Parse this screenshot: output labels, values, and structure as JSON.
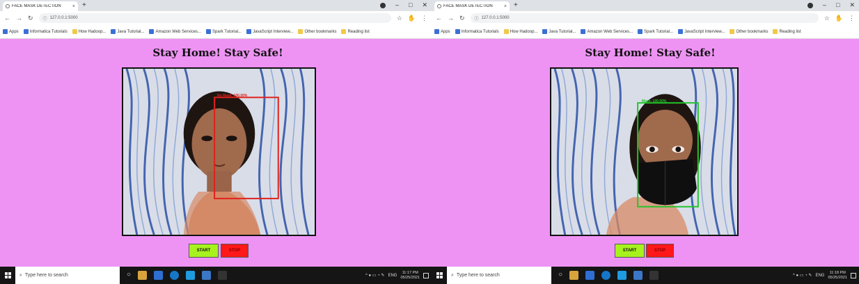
{
  "screens": [
    {
      "id": "left",
      "browser": {
        "tab_title": "FACE MASK DETECTION",
        "tab_close": "×",
        "new_tab": "+",
        "window_controls": [
          "–",
          "□",
          "✕"
        ],
        "address": "127.0.0.1:5000",
        "bookmarks": [
          "Apps",
          "Informatica Tutorials",
          "How Hadoop...",
          "Java Tutorial...",
          "Amazon Web Services...",
          "Spark Tutorial...",
          "JavaScript Interview...",
          "Other bookmarks",
          "Reading list"
        ]
      },
      "page": {
        "heading": "Stay Home! Stay Safe!"
      },
      "camera": {
        "detection_label": "No Mask: 100.00%",
        "box_color": "#e0201c",
        "wearing_mask": false
      },
      "buttons": {
        "start": "START",
        "stop": "STOP"
      },
      "taskbar": {
        "search_placeholder": "Type here to search",
        "tray_lang": "ENG",
        "time": "11:17 PM",
        "date": "05/25/2021"
      }
    },
    {
      "id": "right",
      "browser": {
        "tab_title": "FACE MASK DETECTION",
        "tab_close": "×",
        "new_tab": "+",
        "window_controls": [
          "–",
          "□",
          "✕"
        ],
        "address": "127.0.0.1:5000",
        "bookmarks": [
          "Apps",
          "Informatica Tutorials",
          "How Hadoop...",
          "Java Tutorial...",
          "Amazon Web Services...",
          "Spark Tutorial...",
          "JavaScript Interview...",
          "Other bookmarks",
          "Reading list"
        ]
      },
      "page": {
        "heading": "Stay Home! Stay Safe!"
      },
      "camera": {
        "detection_label": "Mask: 100.00%",
        "box_color": "#22c42a",
        "wearing_mask": true
      },
      "buttons": {
        "start": "START",
        "stop": "STOP"
      },
      "taskbar": {
        "search_placeholder": "Type here to search",
        "tray_lang": "ENG",
        "time": "11:18 PM",
        "date": "05/25/2021"
      }
    }
  ],
  "colors": {
    "page_bg": "#ee93f4",
    "start_btn": "#a7f21e",
    "stop_btn": "#ff1818"
  },
  "icons": [
    "chrome-favicon",
    "back-icon",
    "forward-icon",
    "reload-icon",
    "info-icon",
    "star-icon",
    "extension-icon",
    "profile-icon",
    "menu-icon",
    "windows-logo-icon",
    "search-icon"
  ]
}
